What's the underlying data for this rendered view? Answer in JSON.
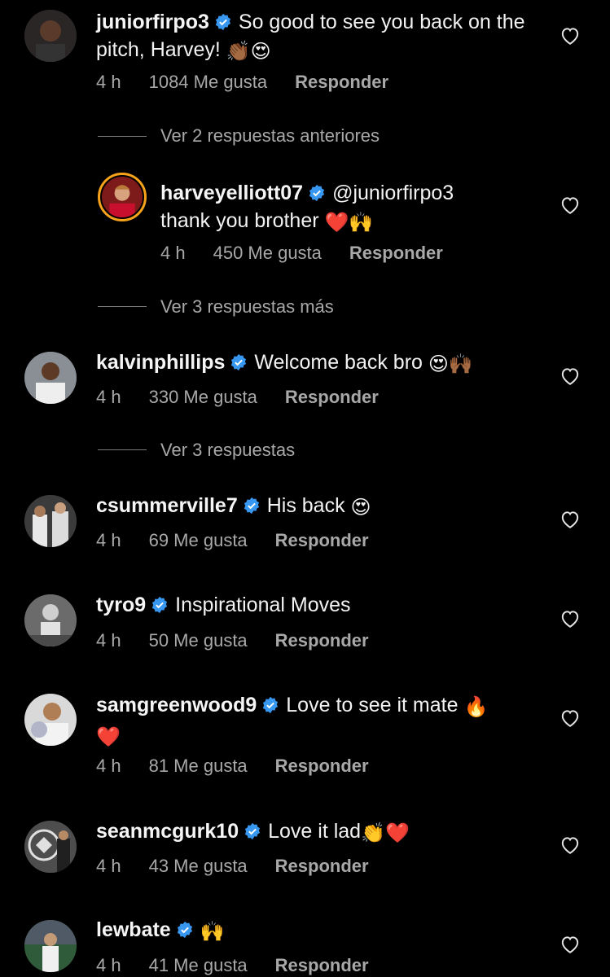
{
  "comments": [
    {
      "username": "juniorfirpo3",
      "text": "So good to see you back on the pitch, Harvey!",
      "emoji": "👏🏾😍",
      "time": "4 h",
      "likes": "1084 Me gusta",
      "reply": "Responder"
    },
    {
      "username": "harveyelliott07",
      "mention": "@juniorfirpo3",
      "text": "thank you brother",
      "emoji": "❤️🙌",
      "time": "4 h",
      "likes": "450 Me gusta",
      "reply": "Responder"
    },
    {
      "username": "kalvinphillips",
      "text": "Welcome back bro",
      "emoji": "😍🙌🏾",
      "time": "4 h",
      "likes": "330 Me gusta",
      "reply": "Responder"
    },
    {
      "username": "csummerville7",
      "text": "His back",
      "emoji": "😍",
      "time": "4 h",
      "likes": "69 Me gusta",
      "reply": "Responder"
    },
    {
      "username": "tyro9",
      "text": "Inspirational Moves",
      "emoji": "",
      "time": "4 h",
      "likes": "50 Me gusta",
      "reply": "Responder"
    },
    {
      "username": "samgreenwood9",
      "text": "Love to see it mate",
      "emoji": "🔥",
      "emoji2": "❤️",
      "time": "4 h",
      "likes": "81 Me gusta",
      "reply": "Responder"
    },
    {
      "username": "seanmcgurk10",
      "text": "Love it lad",
      "emoji": "👏❤️",
      "time": "4 h",
      "likes": "43 Me gusta",
      "reply": "Responder"
    },
    {
      "username": "lewbate",
      "text": "",
      "emoji": "🙌",
      "time": "4 h",
      "likes": "41 Me gusta",
      "reply": "Responder"
    }
  ],
  "threads": {
    "prev_replies": "Ver 2 respuestas anteriores",
    "more_replies": "Ver 3 respuestas más",
    "kalvin_replies": "Ver 3 respuestas"
  },
  "colors": {
    "background": "#000000",
    "text": "#f2f2f2",
    "muted": "#a8a8a8",
    "verified": "#3897f0"
  },
  "icons": {
    "verified": "verified-badge-icon",
    "like": "heart-outline-icon"
  }
}
